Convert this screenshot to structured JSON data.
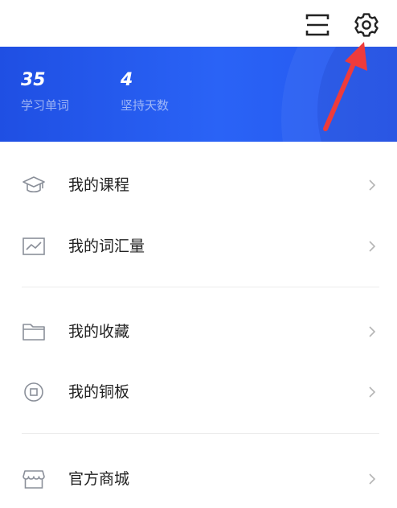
{
  "header": {
    "scan_icon": "scan-icon",
    "settings_icon": "gear-icon"
  },
  "stats": {
    "words_value": "35",
    "words_label": "学习单词",
    "days_value": "4",
    "days_label": "坚持天数"
  },
  "menu": {
    "items": [
      {
        "label": "我的课程",
        "icon": "graduation-cap-icon"
      },
      {
        "label": "我的词汇量",
        "icon": "chart-icon"
      },
      {
        "label": "我的收藏",
        "icon": "folder-icon"
      },
      {
        "label": "我的铜板",
        "icon": "coin-icon"
      },
      {
        "label": "官方商城",
        "icon": "shop-icon"
      }
    ]
  },
  "colors": {
    "banner": "#2a63f6",
    "annotation_arrow": "#ee3b3b",
    "icon_gray": "#8a8f99",
    "chevron_gray": "#b5b5b5"
  }
}
